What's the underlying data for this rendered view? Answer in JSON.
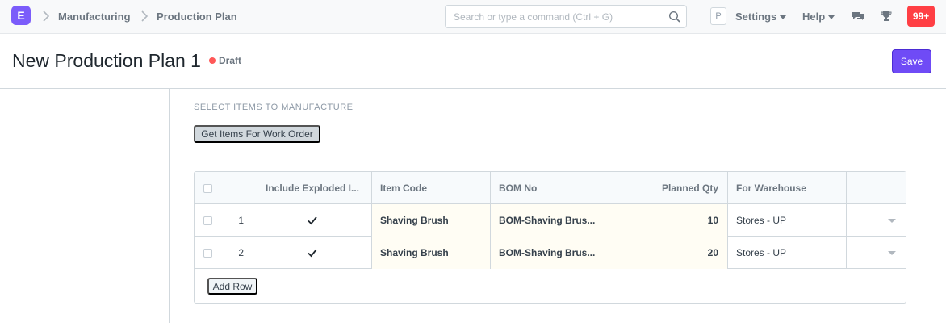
{
  "nav": {
    "logo_letter": "E",
    "breadcrumbs": [
      "Manufacturing",
      "Production Plan"
    ],
    "search_placeholder": "Search or type a command (Ctrl + G)",
    "avatar_letter": "P",
    "settings_label": "Settings",
    "help_label": "Help",
    "notification_count": "99+"
  },
  "page": {
    "title": "New Production Plan 1",
    "status": "Draft",
    "save_label": "Save"
  },
  "section": {
    "label": "SELECT ITEMS TO MANUFACTURE",
    "get_items_label": "Get Items For Work Order"
  },
  "grid": {
    "columns": [
      "Include Exploded I...",
      "Item Code",
      "BOM No",
      "Planned Qty",
      "For Warehouse"
    ],
    "rows": [
      {
        "idx": "1",
        "include_exploded": true,
        "item_code": "Shaving Brush",
        "bom_no": "BOM-Shaving Brus...",
        "planned_qty": "10",
        "warehouse": "Stores - UP"
      },
      {
        "idx": "2",
        "include_exploded": true,
        "item_code": "Shaving Brush",
        "bom_no": "BOM-Shaving Brus...",
        "planned_qty": "20",
        "warehouse": "Stores - UP"
      }
    ],
    "add_row_label": "Add Row"
  },
  "colors": {
    "brand": "#7b5cfa",
    "primary_button": "#6f4bf6",
    "badge": "#ff3f44",
    "draft_indicator": "#ff5858"
  }
}
